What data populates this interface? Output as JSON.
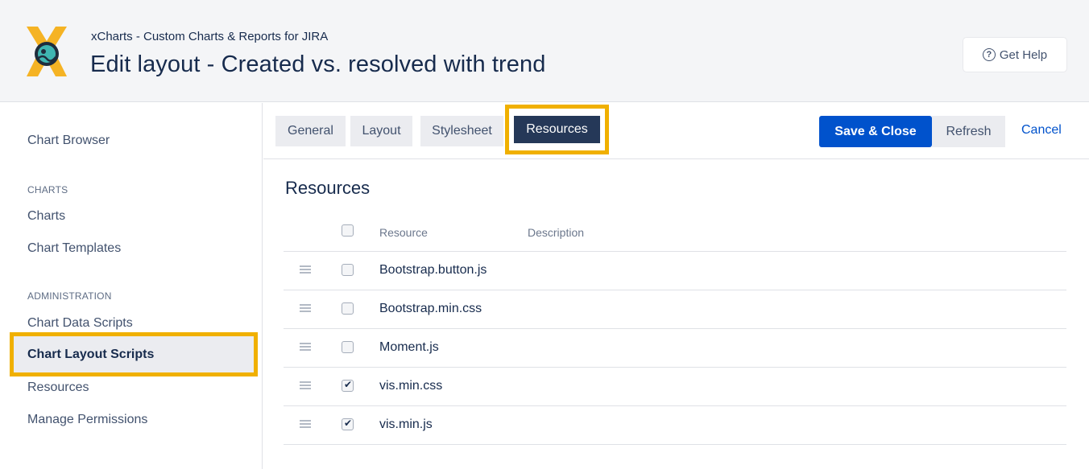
{
  "header": {
    "app_title": "xCharts - Custom Charts & Reports for JIRA",
    "page_title": "Edit layout - Created vs. resolved with trend",
    "help_label": "Get Help",
    "help_icon": "?"
  },
  "sidebar": {
    "chart_browser": "Chart Browser",
    "charts_heading": "CHARTS",
    "charts": "Charts",
    "chart_templates": "Chart Templates",
    "admin_heading": "ADMINISTRATION",
    "chart_data_scripts": "Chart Data Scripts",
    "chart_layout_scripts": "Chart Layout Scripts",
    "resources": "Resources",
    "manage_permissions": "Manage Permissions"
  },
  "tabs": {
    "general": "General",
    "layout": "Layout",
    "stylesheet": "Stylesheet",
    "resources": "Resources"
  },
  "actions": {
    "save_close": "Save & Close",
    "refresh": "Refresh",
    "cancel": "Cancel"
  },
  "main": {
    "title": "Resources",
    "columns": {
      "resource": "Resource",
      "description": "Description"
    },
    "rows": [
      {
        "name": "Bootstrap.button.js",
        "checked": false
      },
      {
        "name": "Bootstrap.min.css",
        "checked": false
      },
      {
        "name": "Moment.js",
        "checked": false
      },
      {
        "name": "vis.min.css",
        "checked": true
      },
      {
        "name": "vis.min.js",
        "checked": true
      }
    ]
  },
  "colors": {
    "highlight": "#f0b000",
    "primary": "#0052cc",
    "active_tab": "#253858"
  }
}
